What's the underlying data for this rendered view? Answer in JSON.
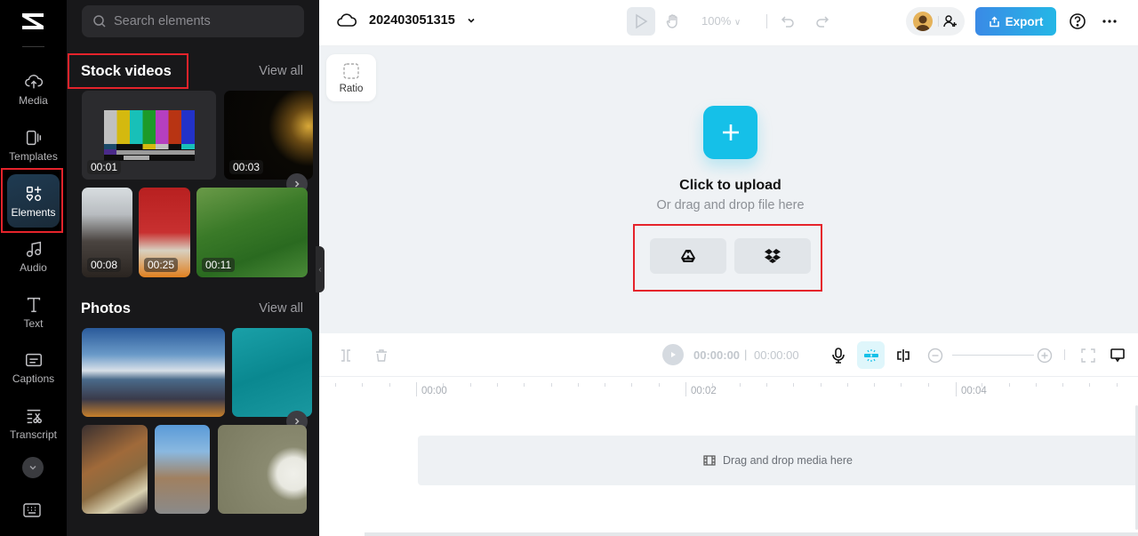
{
  "rail": {
    "items": [
      {
        "label": "Media",
        "icon": "cloud-upload-icon"
      },
      {
        "label": "Templates",
        "icon": "templates-icon"
      },
      {
        "label": "Elements",
        "icon": "elements-icon",
        "active": true
      },
      {
        "label": "Audio",
        "icon": "music-note-icon"
      },
      {
        "label": "Text",
        "icon": "text-icon"
      },
      {
        "label": "Captions",
        "icon": "captions-icon"
      },
      {
        "label": "Transcript",
        "icon": "transcript-icon"
      }
    ]
  },
  "panel": {
    "search_placeholder": "Search elements",
    "stock_videos": {
      "title": "Stock videos",
      "view_all": "View all",
      "items": [
        {
          "duration": "00:01",
          "desc": "color bars test pattern"
        },
        {
          "duration": "00:03",
          "desc": "gold particles"
        },
        {
          "duration": "00:08",
          "desc": "typing on laptop"
        },
        {
          "duration": "00:25",
          "desc": "man presenting"
        },
        {
          "duration": "00:11",
          "desc": "tea plantation"
        }
      ]
    },
    "photos": {
      "title": "Photos",
      "view_all": "View all",
      "items": [
        {
          "desc": "city skyline at sunset"
        },
        {
          "desc": "boat on turquoise sea"
        },
        {
          "desc": "tacos on board"
        },
        {
          "desc": "european street"
        },
        {
          "desc": "white puppy on grass"
        }
      ]
    }
  },
  "topbar": {
    "project_name": "202403051315",
    "zoom_level": "100%",
    "export_label": "Export"
  },
  "canvas": {
    "ratio_label": "Ratio",
    "upload_title": "Click to upload",
    "upload_subtitle": "Or drag and drop file here",
    "cloud_sources": [
      "Google Drive",
      "Dropbox"
    ]
  },
  "timeline": {
    "current_time": "00:00:00",
    "separator": "|",
    "total_time": "00:00:00",
    "ruler_labels": [
      "00:00",
      "00:02",
      "00:04"
    ],
    "drop_text": "Drag and drop media here"
  },
  "colors": {
    "accent": "#15c0e8",
    "export_start": "#3a8ae6",
    "export_end": "#24b7e6",
    "highlight": "#e5232b"
  }
}
